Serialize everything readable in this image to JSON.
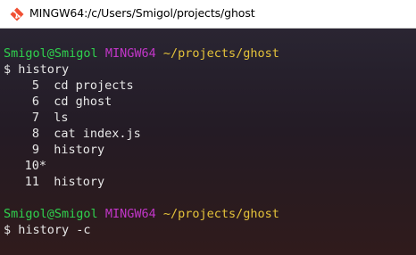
{
  "window": {
    "title": "MINGW64:/c/Users/Smigol/projects/ghost",
    "icon": "git-bash-icon"
  },
  "prompts": [
    {
      "user_host": "Smigol@Smigol",
      "system": "MINGW64",
      "path": "~/projects/ghost",
      "command": "$ history"
    },
    {
      "user_host": "Smigol@Smigol",
      "system": "MINGW64",
      "path": "~/projects/ghost",
      "command": "$ history -c"
    }
  ],
  "history_entries": [
    {
      "num": "5",
      "cmd": "cd projects"
    },
    {
      "num": "6",
      "cmd": "cd ghost"
    },
    {
      "num": "7",
      "cmd": "ls"
    },
    {
      "num": "8",
      "cmd": "cat index.js"
    },
    {
      "num": "9",
      "cmd": "history"
    },
    {
      "num": "10*",
      "cmd": ""
    },
    {
      "num": "11",
      "cmd": "history"
    }
  ],
  "colors": {
    "user_host": "#2fd24e",
    "system": "#c236c8",
    "path": "#e5c33a",
    "text": "#e8e8e8"
  }
}
